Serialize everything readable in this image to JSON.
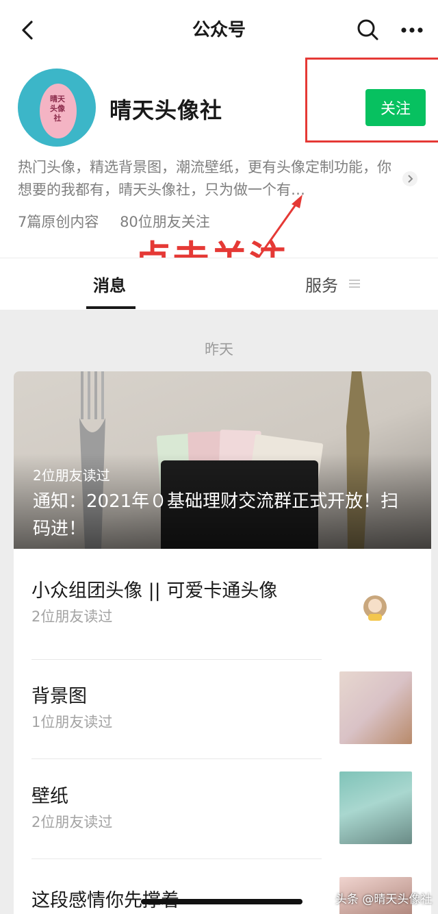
{
  "header": {
    "title": "公众号"
  },
  "profile": {
    "name": "晴天头像社",
    "avatar_text": "晴天头像社",
    "follow_label": "关注",
    "description": "热门头像，精选背景图，潮流壁纸，更有头像定制功能，你想要的我都有，晴天头像社，只为做一个有…",
    "stats": {
      "articles": "7篇原创内容",
      "friends": "80位朋友关注"
    }
  },
  "annotation": "点击关注",
  "tabs": {
    "messages": "消息",
    "services": "服务"
  },
  "feed": {
    "date": "昨天",
    "hero": {
      "reads": "2位朋友读过",
      "title": "通知：2021年０基础理财交流群正式开放！扫码进！"
    },
    "items": [
      {
        "title": "小众组团头像 || 可爱卡通头像",
        "reads": "2位朋友读过"
      },
      {
        "title": "背景图",
        "reads": "1位朋友读过"
      },
      {
        "title": "壁纸",
        "reads": "2位朋友读过"
      },
      {
        "title": "这段感情你先撑着",
        "reads": ""
      }
    ]
  },
  "watermark": "头条 @晴天头像社",
  "colors": {
    "follow_green": "#07c160",
    "annotation_red": "#e53935"
  }
}
